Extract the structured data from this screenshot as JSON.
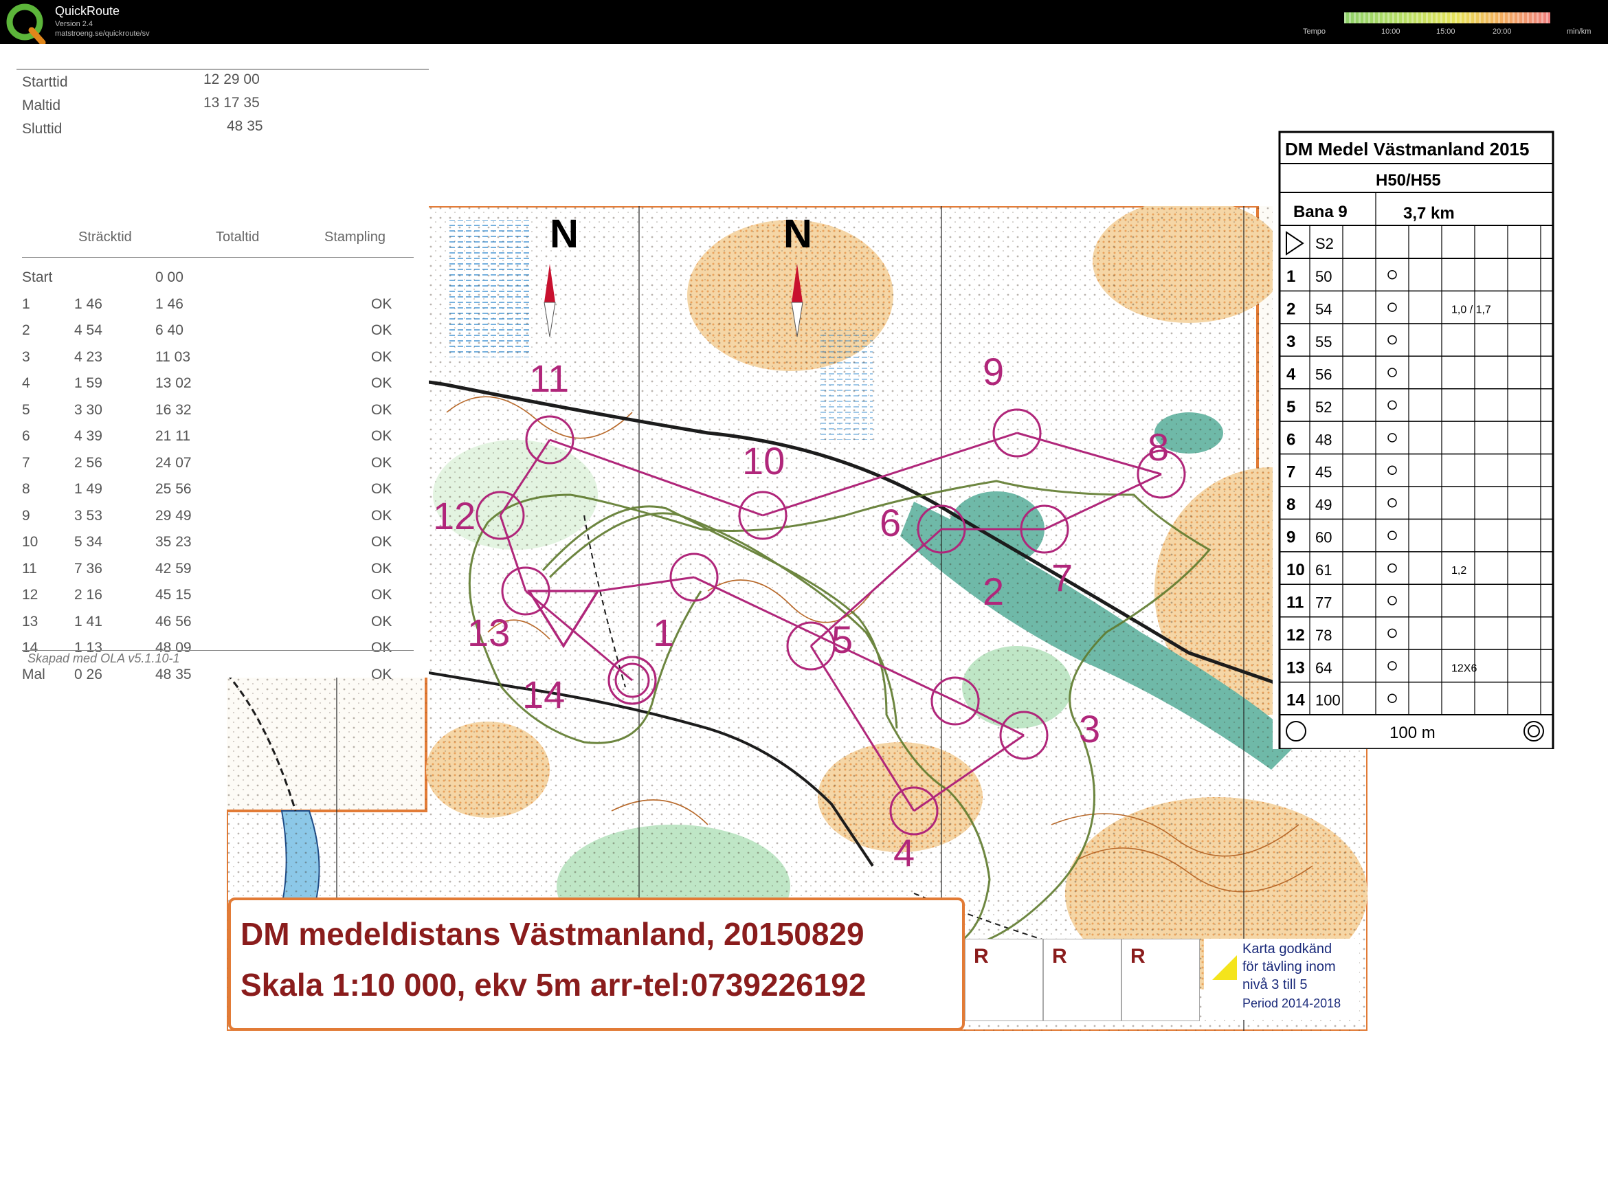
{
  "app": {
    "name": "QuickRoute",
    "version": "Version 2.4",
    "url": "matstroeng.se/quickroute/sv",
    "tempo_label": "Tempo",
    "tempo_ticks": [
      "10:00",
      "15:00",
      "20:00"
    ],
    "tempo_unit": "min/km"
  },
  "splits": {
    "start_label": "Starttid",
    "start_value": "12 29 00",
    "finish_label": "Maltid",
    "finish_value": "13 17 35",
    "end_label": "Sluttid",
    "end_value": "48 35",
    "col_split": "Sträcktid",
    "col_total": "Totaltid",
    "col_punch": "Stampling",
    "rows": [
      {
        "leg": "Start",
        "split": "",
        "total": "0 00",
        "status": ""
      },
      {
        "leg": "1",
        "split": "1 46",
        "total": "1 46",
        "status": "OK"
      },
      {
        "leg": "2",
        "split": "4 54",
        "total": "6 40",
        "status": "OK"
      },
      {
        "leg": "3",
        "split": "4 23",
        "total": "11 03",
        "status": "OK"
      },
      {
        "leg": "4",
        "split": "1 59",
        "total": "13 02",
        "status": "OK"
      },
      {
        "leg": "5",
        "split": "3 30",
        "total": "16 32",
        "status": "OK"
      },
      {
        "leg": "6",
        "split": "4 39",
        "total": "21 11",
        "status": "OK"
      },
      {
        "leg": "7",
        "split": "2 56",
        "total": "24 07",
        "status": "OK"
      },
      {
        "leg": "8",
        "split": "1 49",
        "total": "25 56",
        "status": "OK"
      },
      {
        "leg": "9",
        "split": "3 53",
        "total": "29 49",
        "status": "OK"
      },
      {
        "leg": "10",
        "split": "5 34",
        "total": "35 23",
        "status": "OK"
      },
      {
        "leg": "11",
        "split": "7 36",
        "total": "42 59",
        "status": "OK"
      },
      {
        "leg": "12",
        "split": "2 16",
        "total": "45 15",
        "status": "OK"
      },
      {
        "leg": "13",
        "split": "1 41",
        "total": "46 56",
        "status": "OK"
      },
      {
        "leg": "14",
        "split": "1 13",
        "total": "48 09",
        "status": "OK"
      },
      {
        "leg": "Mal",
        "split": "0 26",
        "total": "48 35",
        "status": "OK"
      }
    ],
    "credit": "Skapad med OLA v5.1.10-1"
  },
  "description": {
    "event": "DM Medel Västmanland 2015",
    "classes": "H50/H55",
    "course": "Bana 9",
    "length": "3,7 km",
    "start_code": "S2",
    "controls": [
      {
        "n": "1",
        "code": "50"
      },
      {
        "n": "2",
        "code": "54",
        "extra": "1,0 / 1,7"
      },
      {
        "n": "3",
        "code": "55"
      },
      {
        "n": "4",
        "code": "56"
      },
      {
        "n": "5",
        "code": "52"
      },
      {
        "n": "6",
        "code": "48"
      },
      {
        "n": "7",
        "code": "45"
      },
      {
        "n": "8",
        "code": "49"
      },
      {
        "n": "9",
        "code": "60"
      },
      {
        "n": "10",
        "code": "61",
        "extra": "1,2"
      },
      {
        "n": "11",
        "code": "77"
      },
      {
        "n": "12",
        "code": "78"
      },
      {
        "n": "13",
        "code": "64",
        "extra": "12X6"
      },
      {
        "n": "14",
        "code": "100"
      }
    ],
    "finish_distance": "100 m"
  },
  "map": {
    "north": "N",
    "control_labels": [
      "1",
      "2",
      "3",
      "4",
      "5",
      "6",
      "7",
      "8",
      "9",
      "10",
      "11",
      "12",
      "13",
      "14"
    ],
    "colors": {
      "course": "#b0267a",
      "route": "#5e7a2c",
      "forest": "#ffffff",
      "open": "#f2c48a",
      "water": "#6fb9a8",
      "contour": "#b8692a"
    }
  },
  "titlebox": {
    "line1": "DM medeldistans Västmanland, 20150829",
    "line2": "Skala 1:10 000, ekv 5m  arr-tel:0739226192",
    "r_labels": [
      "R",
      "R",
      "R"
    ]
  },
  "approval": {
    "line1": "Karta godkänd",
    "line2": "för tävling inom",
    "line3": "nivå 3 till 5",
    "line4": "Period 2014-2018"
  }
}
